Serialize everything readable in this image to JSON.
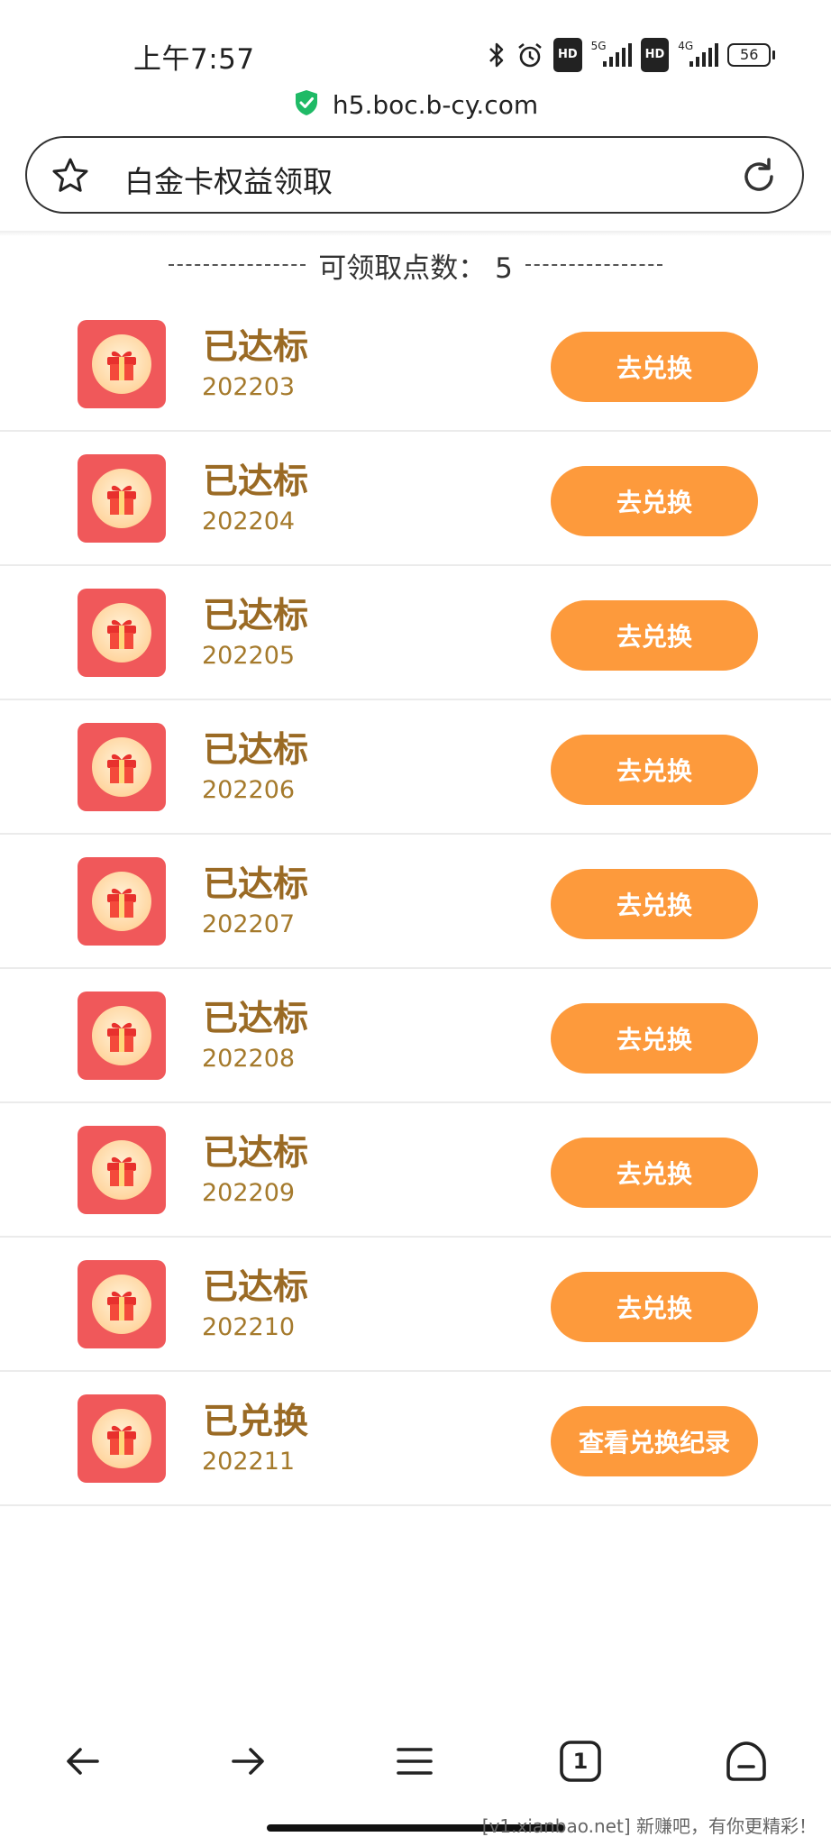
{
  "status_bar": {
    "time": "上午7:57",
    "network_5g": "5G",
    "network_4g": "4G",
    "hd_label": "HD",
    "battery": "56"
  },
  "browser": {
    "url": "h5.boc.b-cy.com",
    "page_title": "白金卡权益领取",
    "secure_icon": "shield-check-icon",
    "accent": "#1fba66"
  },
  "points": {
    "label": "可领取点数：",
    "value": "5"
  },
  "items": [
    {
      "status": "已达标",
      "date": "202203",
      "button": "去兑换"
    },
    {
      "status": "已达标",
      "date": "202204",
      "button": "去兑换"
    },
    {
      "status": "已达标",
      "date": "202205",
      "button": "去兑换"
    },
    {
      "status": "已达标",
      "date": "202206",
      "button": "去兑换"
    },
    {
      "status": "已达标",
      "date": "202207",
      "button": "去兑换"
    },
    {
      "status": "已达标",
      "date": "202208",
      "button": "去兑换"
    },
    {
      "status": "已达标",
      "date": "202209",
      "button": "去兑换"
    },
    {
      "status": "已达标",
      "date": "202210",
      "button": "去兑换"
    },
    {
      "status": "已兑换",
      "date": "202211",
      "button": "查看兑换纪录"
    }
  ],
  "colors": {
    "button": "#fd9a3c",
    "title_text": "#9a6a24",
    "icon_bg": "#f0585a"
  },
  "nav": {
    "tab_count": "1"
  },
  "watermark": "[v1.xianbao.net] 新赚吧，有你更精彩！"
}
